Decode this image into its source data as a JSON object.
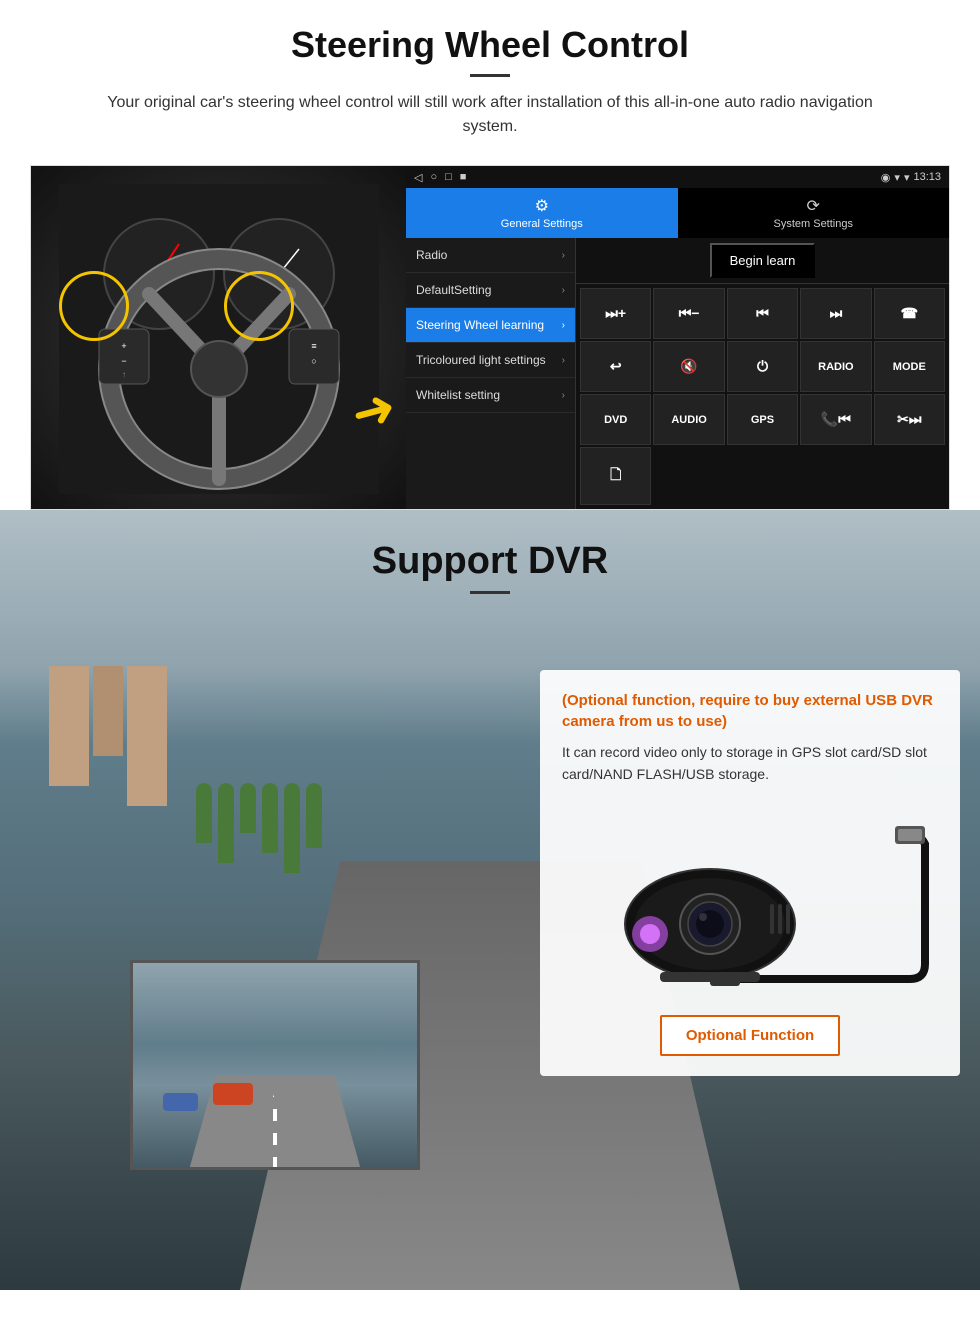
{
  "steering_section": {
    "title": "Steering Wheel Control",
    "description": "Your original car's steering wheel control will still work after installation of this all-in-one auto radio navigation system.",
    "android_ui": {
      "statusbar": {
        "nav_icons": [
          "◁",
          "○",
          "□",
          "■"
        ],
        "signal": "▼",
        "wifi": "▾",
        "time": "13:13"
      },
      "tabs": [
        {
          "icon": "⚙",
          "label": "General Settings",
          "active": true
        },
        {
          "icon": "⟳",
          "label": "System Settings",
          "active": false
        }
      ],
      "menu_items": [
        {
          "label": "Radio",
          "active": false
        },
        {
          "label": "DefaultSetting",
          "active": false
        },
        {
          "label": "Steering Wheel learning",
          "active": true
        },
        {
          "label": "Tricoloured light settings",
          "active": false
        },
        {
          "label": "Whitelist setting",
          "active": false
        }
      ],
      "begin_learn_label": "Begin learn",
      "control_buttons": [
        "⏭+",
        "⏮−",
        "⏮⏮",
        "⏭⏭",
        "☎",
        "↩",
        "🔇×",
        "⏻",
        "RADIO",
        "MODE",
        "DVD",
        "AUDIO",
        "GPS",
        "📞⏮",
        "✂⏭",
        "📋"
      ]
    }
  },
  "dvr_section": {
    "title": "Support DVR",
    "info_card": {
      "optional_text": "(Optional function, require to buy external USB DVR camera from us to use)",
      "description": "It can record video only to storage in GPS slot card/SD slot card/NAND FLASH/USB storage."
    },
    "optional_function_btn_label": "Optional Function"
  }
}
